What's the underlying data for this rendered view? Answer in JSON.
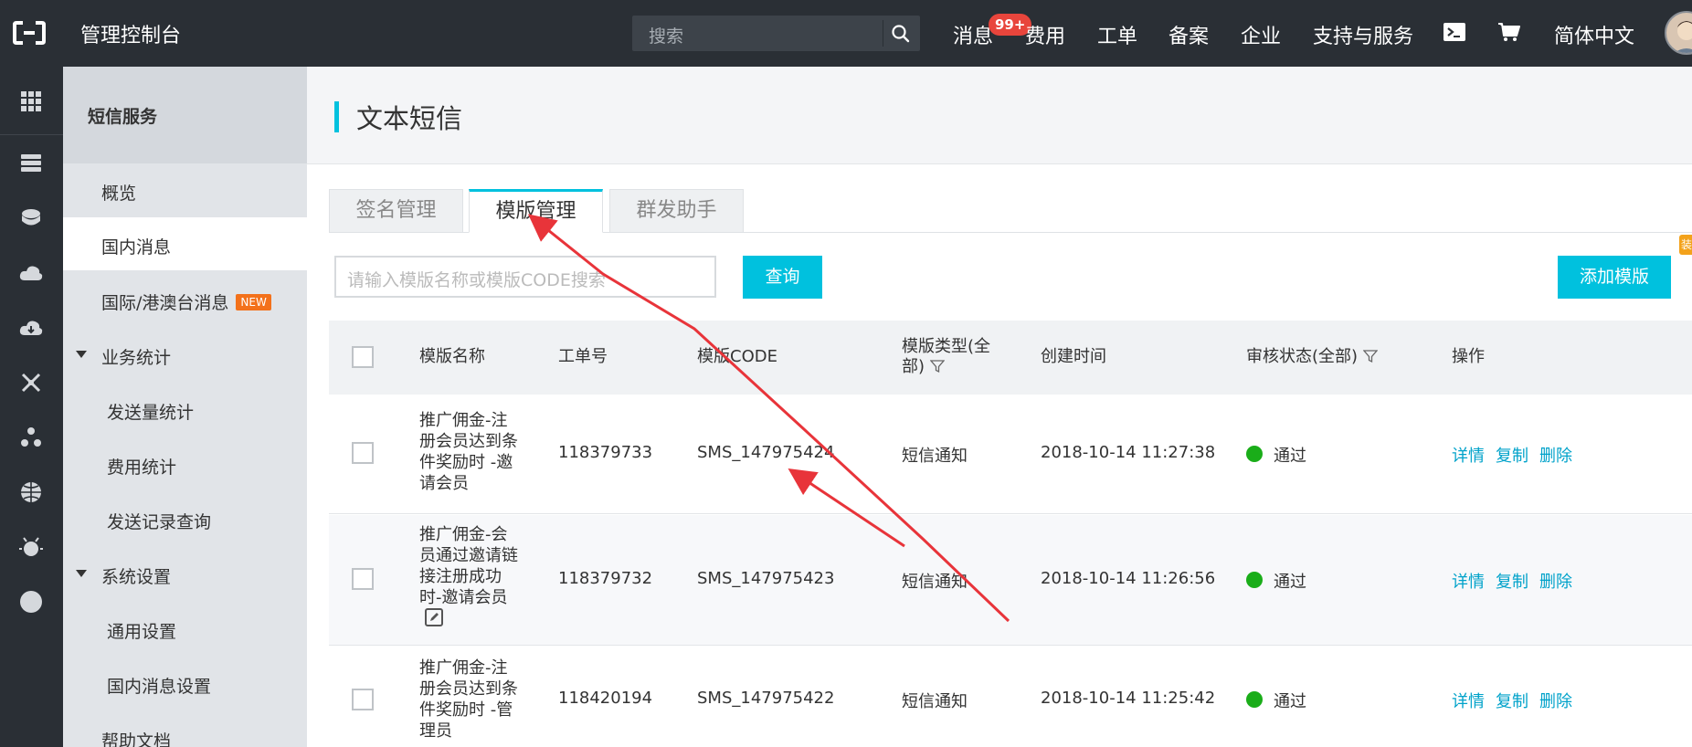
{
  "topbar": {
    "title": "管理控制台",
    "search_placeholder": "搜索",
    "nav": {
      "messages": "消息",
      "messages_badge": "99+",
      "fees": "费用",
      "tickets": "工单",
      "filing": "备案",
      "enterprise": "企业",
      "support": "支持与服务",
      "language": "简体中文"
    }
  },
  "subnav": {
    "title": "短信服务",
    "items": {
      "overview": "概览",
      "domestic": "国内消息",
      "international": "国际/港澳台消息",
      "international_badge": "NEW",
      "stats_group": "业务统计",
      "send_stats": "发送量统计",
      "fee_stats": "费用统计",
      "send_records": "发送记录查询",
      "settings_group": "系统设置",
      "general_settings": "通用设置",
      "domestic_settings": "国内消息设置",
      "help": "帮助文档"
    }
  },
  "main": {
    "title": "文本短信",
    "tabs": [
      "签名管理",
      "模版管理",
      "群发助手"
    ],
    "active_tab": 1,
    "search_placeholder": "请输入模版名称或模版CODE搜索",
    "query_button": "查询",
    "add_button": "添加模版",
    "corner_tag": "装"
  },
  "table": {
    "headers": {
      "name": "模版名称",
      "ticket": "工单号",
      "code": "模版CODE",
      "type_line1": "模版类型(全",
      "type_line2": "部)",
      "created": "创建时间",
      "status": "审核状态(全部)",
      "ops": "操作"
    },
    "rows": [
      {
        "name": "推广佣金-注册会员达到条件奖励时 -邀请会员",
        "ticket": "118379733",
        "code": "SMS_147975424",
        "type": "短信通知",
        "created": "2018-10-14 11:27:38",
        "status": "通过",
        "ops": [
          "详情",
          "复制",
          "删除"
        ]
      },
      {
        "name": "推广佣金-会员通过邀请链接注册成功时-邀请会员",
        "ticket": "118379732",
        "code": "SMS_147975423",
        "type": "短信通知",
        "created": "2018-10-14 11:26:56",
        "status": "通过",
        "ops": [
          "详情",
          "复制",
          "删除"
        ]
      },
      {
        "name": "推广佣金-注册会员达到条件奖励时 -管理员",
        "ticket": "118420194",
        "code": "SMS_147975422",
        "type": "短信通知",
        "created": "2018-10-14 11:25:42",
        "status": "通过",
        "ops": [
          "详情",
          "复制",
          "删除"
        ]
      }
    ]
  },
  "colors": {
    "accent": "#00c1de",
    "topbar_bg": "#2a2f35",
    "status_pass": "#1aad19",
    "link": "#00a2ca",
    "annotation": "#e8343a"
  }
}
